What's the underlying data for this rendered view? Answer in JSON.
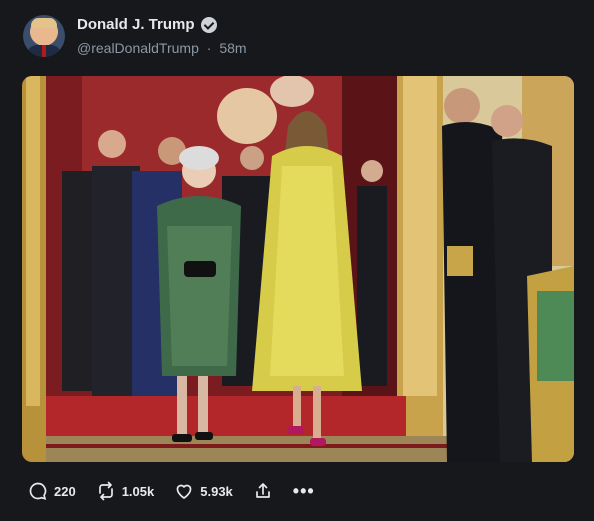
{
  "post": {
    "author_name": "Donald J. Trump",
    "handle": "@realDonaldTrump",
    "separator": "·",
    "time": "58m"
  },
  "actions": {
    "replies": "220",
    "reposts": "1.05k",
    "likes": "5.93k",
    "more": "•••"
  }
}
